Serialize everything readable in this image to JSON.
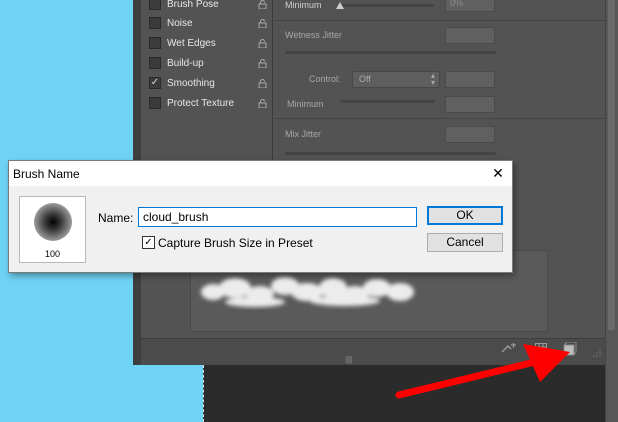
{
  "brush_options": {
    "items": [
      {
        "label": "Brush Pose",
        "checked": false
      },
      {
        "label": "Noise",
        "checked": false
      },
      {
        "label": "Wet Edges",
        "checked": false
      },
      {
        "label": "Build-up",
        "checked": false
      },
      {
        "label": "Smoothing",
        "checked": true
      },
      {
        "label": "Protect Texture",
        "checked": false
      }
    ]
  },
  "settings": {
    "minimum_label": "Minimum",
    "minimum_value": "0%",
    "wetness_jitter_label": "Wetness Jitter",
    "control_label": "Control:",
    "control_value": "Off",
    "minimum2_label": "Minimum",
    "mix_jitter_label": "Mix Jitter"
  },
  "dialog": {
    "title": "Brush Name",
    "close_glyph": "✕",
    "brush_size": "100",
    "name_label": "Name:",
    "name_value": "cloud_brush",
    "ok_label": "OK",
    "cancel_label": "Cancel",
    "capture_label": "Capture Brush Size in Preset",
    "capture_checked": true
  },
  "icons": {
    "lock": "lock-icon",
    "toggle_projection": "toggle-projection-icon",
    "grid": "brush-grid-icon",
    "new_preset": "create-new-brush-icon"
  },
  "colors": {
    "background": "#6fd3f5",
    "panel": "#535353",
    "arrow": "#ff0000",
    "dialog_accent": "#0078d7"
  }
}
